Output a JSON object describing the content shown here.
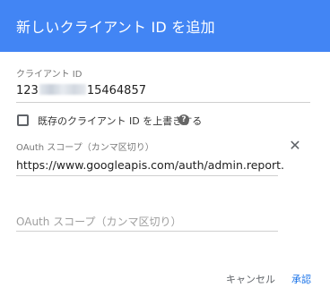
{
  "dialog": {
    "title": "新しいクライアント ID を追加",
    "client_id": {
      "label": "クライアント ID",
      "value_prefix": "123",
      "value_suffix": "15464857"
    },
    "checkbox": {
      "label": "既存のクライアント ID を上書きする",
      "checked": false,
      "help_icon": "help-circle-icon"
    },
    "scope_1": {
      "label": "OAuth スコープ（カンマ区切り）",
      "value": "https://www.googleapis.com/auth/admin.report.",
      "remove_icon": "close-icon"
    },
    "scope_2": {
      "placeholder": "OAuth スコープ（カンマ区切り）"
    },
    "buttons": {
      "cancel": "キャンセル",
      "confirm": "承認"
    },
    "colors": {
      "header": "#4285f4",
      "primary_button": "#1a73e8"
    }
  }
}
